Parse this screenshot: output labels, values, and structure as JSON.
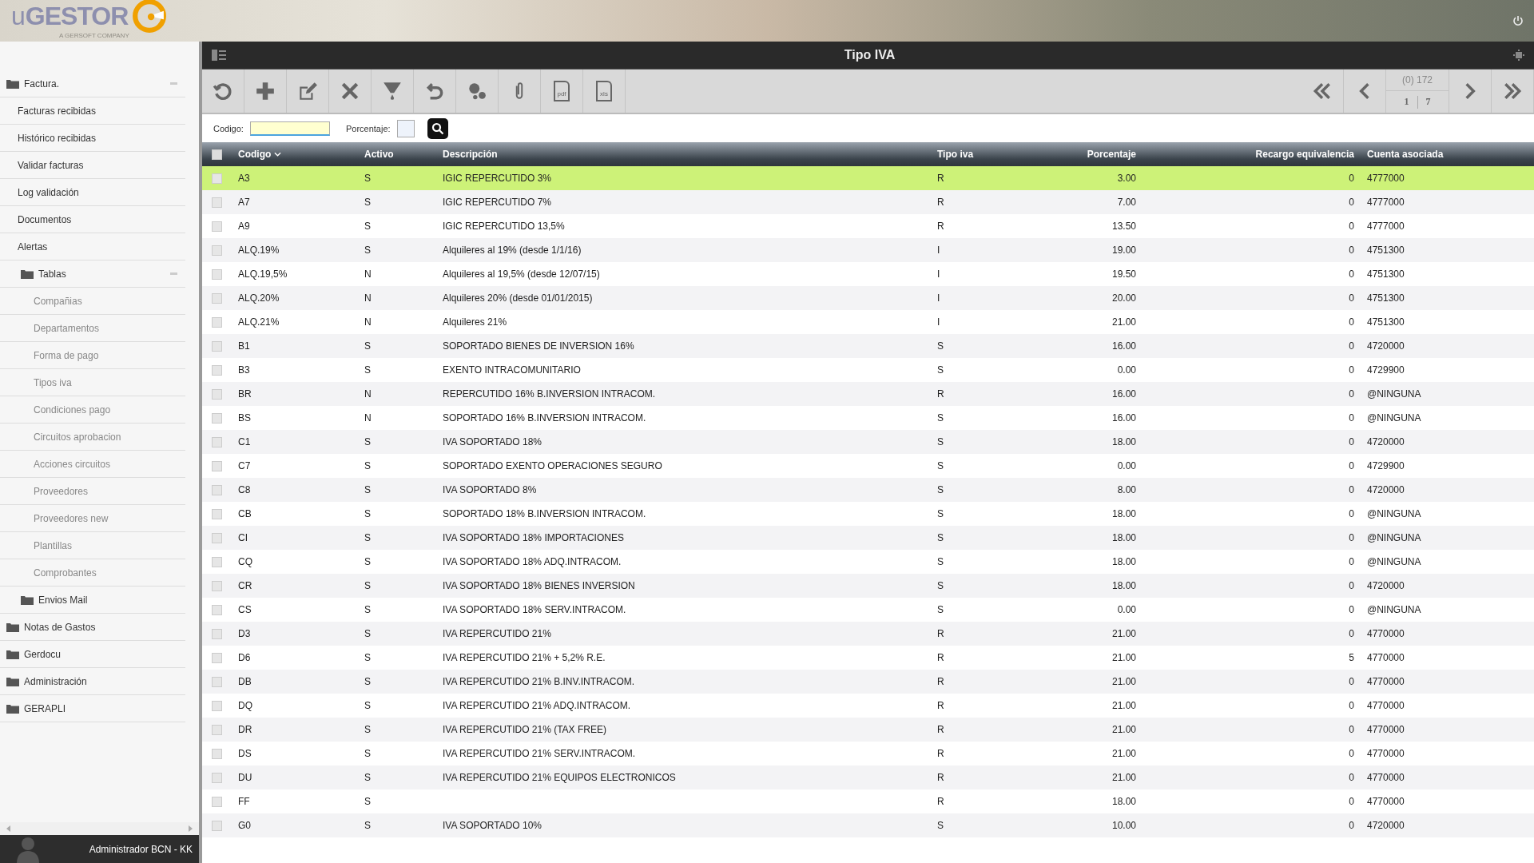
{
  "brand": {
    "name_light": "u",
    "name_bold": "GESTOR",
    "tagline": "A GERSOFT COMPANY"
  },
  "window": {
    "title": "Tipo IVA"
  },
  "toolbar": [
    {
      "kind": "refresh"
    },
    {
      "kind": "add"
    },
    {
      "kind": "edit"
    },
    {
      "kind": "delete"
    },
    {
      "kind": "filter"
    },
    {
      "kind": "undo"
    },
    {
      "kind": "settings"
    },
    {
      "kind": "attach"
    },
    {
      "kind": "file",
      "label": "pdf"
    },
    {
      "kind": "file",
      "label": "xls"
    }
  ],
  "pager": {
    "count": "(0) 172",
    "page": "1",
    "pages": "7"
  },
  "filters": [
    {
      "label": "Codigo:",
      "kind": "text",
      "focused": true
    },
    {
      "label": "Porcentaje:",
      "kind": "small",
      "focused": false
    }
  ],
  "sidebar": {
    "items": [
      {
        "label": "Factura.",
        "expanded": true,
        "children": [
          {
            "label": "Facturas recibidas"
          },
          {
            "label": "Histórico recibidas"
          },
          {
            "label": "Validar facturas"
          },
          {
            "label": "Log validación"
          },
          {
            "label": "Documentos"
          },
          {
            "label": "Alertas"
          },
          {
            "label": "Tablas",
            "expanded": true,
            "children": [
              {
                "label": "Compañias"
              },
              {
                "label": "Departamentos"
              },
              {
                "label": "Forma de pago"
              },
              {
                "label": "Tipos iva"
              },
              {
                "label": "Condiciones pago"
              },
              {
                "label": "Circuitos aprobacion"
              },
              {
                "label": "Acciones circuitos"
              },
              {
                "label": "Proveedores"
              },
              {
                "label": "Proveedores new"
              },
              {
                "label": "Plantillas"
              },
              {
                "label": "Comprobantes"
              }
            ]
          },
          {
            "label": "Envios Mail",
            "expanded": false
          }
        ]
      },
      {
        "label": "Notas de Gastos",
        "expanded": false
      },
      {
        "label": "Gerdocu",
        "expanded": false
      },
      {
        "label": "Administración",
        "expanded": false
      },
      {
        "label": "GERAPLI",
        "expanded": false
      }
    ]
  },
  "user": {
    "name": "Administrador BCN - KK"
  },
  "table": {
    "all_checked": false,
    "columns": [
      "Codigo",
      "Activo",
      "Descripción",
      "Tipo iva",
      "Porcentaje",
      "Recargo equivalencia",
      "Cuenta asociada"
    ],
    "rows": [
      {
        "selected": true,
        "checked": false,
        "cells": [
          "A3",
          "S",
          "IGIC REPERCUTIDO 3%",
          "R",
          "3.00",
          "0",
          "4777000"
        ]
      },
      {
        "selected": false,
        "checked": false,
        "cells": [
          "A7",
          "S",
          "IGIC REPERCUTIDO 7%",
          "R",
          "7.00",
          "0",
          "4777000"
        ]
      },
      {
        "selected": false,
        "checked": false,
        "cells": [
          "A9",
          "S",
          "IGIC REPERCUTIDO 13,5%",
          "R",
          "13.50",
          "0",
          "4777000"
        ]
      },
      {
        "selected": false,
        "checked": false,
        "cells": [
          "ALQ.19%",
          "S",
          "Alquileres al 19% (desde 1/1/16)",
          "I",
          "19.00",
          "0",
          "4751300"
        ]
      },
      {
        "selected": false,
        "checked": false,
        "cells": [
          "ALQ.19,5%",
          "N",
          "Alquileres al 19,5% (desde 12/07/15)",
          "I",
          "19.50",
          "0",
          "4751300"
        ]
      },
      {
        "selected": false,
        "checked": false,
        "cells": [
          "ALQ.20%",
          "N",
          "Alquileres 20% (desde 01/01/2015)",
          "I",
          "20.00",
          "0",
          "4751300"
        ]
      },
      {
        "selected": false,
        "checked": false,
        "cells": [
          "ALQ.21%",
          "N",
          "Alquileres 21%",
          "I",
          "21.00",
          "0",
          "4751300"
        ]
      },
      {
        "selected": false,
        "checked": false,
        "cells": [
          "B1",
          "S",
          "SOPORTADO BIENES DE INVERSION 16%",
          "S",
          "16.00",
          "0",
          "4720000"
        ]
      },
      {
        "selected": false,
        "checked": false,
        "cells": [
          "B3",
          "S",
          "EXENTO INTRACOMUNITARIO",
          "S",
          "0.00",
          "0",
          "4729900"
        ]
      },
      {
        "selected": false,
        "checked": false,
        "cells": [
          "BR",
          "N",
          "REPERCUTIDO 16% B.INVERSION INTRACOM.",
          "R",
          "16.00",
          "0",
          "@NINGUNA"
        ]
      },
      {
        "selected": false,
        "checked": false,
        "cells": [
          "BS",
          "N",
          "SOPORTADO 16% B.INVERSION INTRACOM.",
          "S",
          "16.00",
          "0",
          "@NINGUNA"
        ]
      },
      {
        "selected": false,
        "checked": false,
        "cells": [
          "C1",
          "S",
          "IVA SOPORTADO 18%",
          "S",
          "18.00",
          "0",
          "4720000"
        ]
      },
      {
        "selected": false,
        "checked": false,
        "cells": [
          "C7",
          "S",
          "SOPORTADO EXENTO OPERACIONES SEGURO",
          "S",
          "0.00",
          "0",
          "4729900"
        ]
      },
      {
        "selected": false,
        "checked": false,
        "cells": [
          "C8",
          "S",
          "IVA SOPORTADO 8%",
          "S",
          "8.00",
          "0",
          "4720000"
        ]
      },
      {
        "selected": false,
        "checked": false,
        "cells": [
          "CB",
          "S",
          "SOPORTADO 18% B.INVERSION INTRACOM.",
          "S",
          "18.00",
          "0",
          "@NINGUNA"
        ]
      },
      {
        "selected": false,
        "checked": false,
        "cells": [
          "CI",
          "S",
          "IVA SOPORTADO 18% IMPORTACIONES",
          "S",
          "18.00",
          "0",
          "@NINGUNA"
        ]
      },
      {
        "selected": false,
        "checked": false,
        "cells": [
          "CQ",
          "S",
          "IVA SOPORTADO 18% ADQ.INTRACOM.",
          "S",
          "18.00",
          "0",
          "@NINGUNA"
        ]
      },
      {
        "selected": false,
        "checked": false,
        "cells": [
          "CR",
          "S",
          "IVA SOPORTADO 18% BIENES INVERSION",
          "S",
          "18.00",
          "0",
          "4720000"
        ]
      },
      {
        "selected": false,
        "checked": false,
        "cells": [
          "CS",
          "S",
          "IVA SOPORTADO 18% SERV.INTRACOM.",
          "S",
          "0.00",
          "0",
          "@NINGUNA"
        ]
      },
      {
        "selected": false,
        "checked": false,
        "cells": [
          "D3",
          "S",
          "IVA REPERCUTIDO 21%",
          "R",
          "21.00",
          "0",
          "4770000"
        ]
      },
      {
        "selected": false,
        "checked": false,
        "cells": [
          "D6",
          "S",
          "IVA REPERCUTIDO 21% + 5,2% R.E.",
          "R",
          "21.00",
          "5",
          "4770000"
        ]
      },
      {
        "selected": false,
        "checked": false,
        "cells": [
          "DB",
          "S",
          "IVA REPERCUTIDO 21% B.INV.INTRACOM.",
          "R",
          "21.00",
          "0",
          "4770000"
        ]
      },
      {
        "selected": false,
        "checked": false,
        "cells": [
          "DQ",
          "S",
          "IVA REPERCUTIDO 21% ADQ.INTRACOM.",
          "R",
          "21.00",
          "0",
          "4770000"
        ]
      },
      {
        "selected": false,
        "checked": false,
        "cells": [
          "DR",
          "S",
          "IVA REPERCUTIDO 21% (TAX FREE)",
          "R",
          "21.00",
          "0",
          "4770000"
        ]
      },
      {
        "selected": false,
        "checked": false,
        "cells": [
          "DS",
          "S",
          "IVA REPERCUTIDO 21% SERV.INTRACOM.",
          "R",
          "21.00",
          "0",
          "4770000"
        ]
      },
      {
        "selected": false,
        "checked": false,
        "cells": [
          "DU",
          "S",
          "IVA REPERCUTIDO 21% EQUIPOS ELECTRONICOS",
          "R",
          "21.00",
          "0",
          "4770000"
        ]
      },
      {
        "selected": false,
        "checked": false,
        "cells": [
          "FF",
          "S",
          "",
          "R",
          "18.00",
          "0",
          "4770000"
        ]
      },
      {
        "selected": false,
        "checked": false,
        "cells": [
          "G0",
          "S",
          "IVA SOPORTADO 10%",
          "S",
          "10.00",
          "0",
          "4720000"
        ]
      }
    ]
  }
}
